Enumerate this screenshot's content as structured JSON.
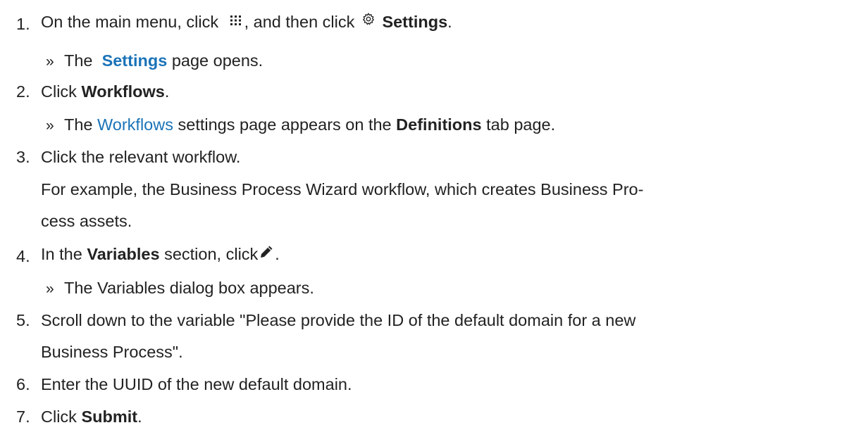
{
  "steps": [
    {
      "number": "1.",
      "parts": {
        "a": "On the main menu, click",
        "b": ", and then click",
        "c": "Settings",
        "d": "."
      },
      "icons": [
        "grid-menu-icon",
        "gear-icon"
      ],
      "result": {
        "marker": "»",
        "a": "The",
        "link": "Settings",
        "b": "page opens."
      }
    },
    {
      "number": "2.",
      "parts": {
        "a": "Click",
        "b": "Workflows",
        "c": "."
      },
      "result": {
        "marker": "»",
        "a": "The",
        "link": "Workflows",
        "b": "settings page appears on the",
        "c": "Definitions",
        "d": "tab page."
      }
    },
    {
      "number": "3.",
      "parts": {
        "a": "Click the relevant workflow."
      },
      "note_line1": "For example, the Business Process Wizard workflow, which creates Business Pro-",
      "note_line2": "cess assets."
    },
    {
      "number": "4.",
      "parts": {
        "a": "In the",
        "b": "Variables",
        "c": "section, click",
        "d": "."
      },
      "icons": [
        "pencil-icon"
      ],
      "result": {
        "marker": "»",
        "a": "The Variables dialog box appears."
      }
    },
    {
      "number": "5.",
      "line1": "Scroll down to the variable \"Please provide the ID of the default domain for a new",
      "line2": "Business Process\"."
    },
    {
      "number": "6.",
      "line1": "Enter the UUID of the new default domain."
    },
    {
      "number": "7.",
      "parts": {
        "a": "Click",
        "b": "Submit",
        "c": "."
      }
    }
  ],
  "colors": {
    "text": "#222222",
    "link": "#1a73b8"
  }
}
